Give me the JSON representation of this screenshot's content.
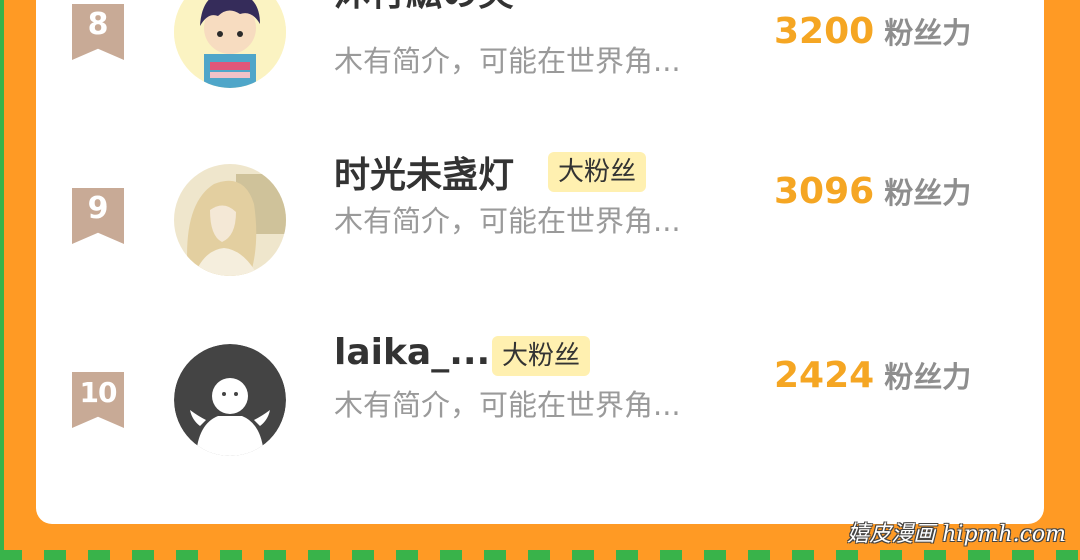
{
  "ranking": {
    "score_unit": "粉丝力",
    "entries": [
      {
        "rank": "8",
        "name": "沐行紘の笑",
        "badge": "",
        "bio": "木有简介，可能在世界角...",
        "score": "3200"
      },
      {
        "rank": "9",
        "name": "时光未盏灯",
        "badge": "大粉丝",
        "bio": "木有简介，可能在世界角...",
        "score": "3096"
      },
      {
        "rank": "10",
        "name": "laika_...",
        "badge": "大粉丝",
        "bio": "木有简介，可能在世界角...",
        "score": "2424"
      }
    ]
  },
  "watermark": {
    "text": "嬉皮漫画 hipmh.com"
  },
  "colors": {
    "page_background": "#FF9A24",
    "edge_green": "#39B34A",
    "rank_ribbon": "#C8AA96",
    "score_accent": "#F5A623",
    "badge_background": "#FFF0B0"
  }
}
